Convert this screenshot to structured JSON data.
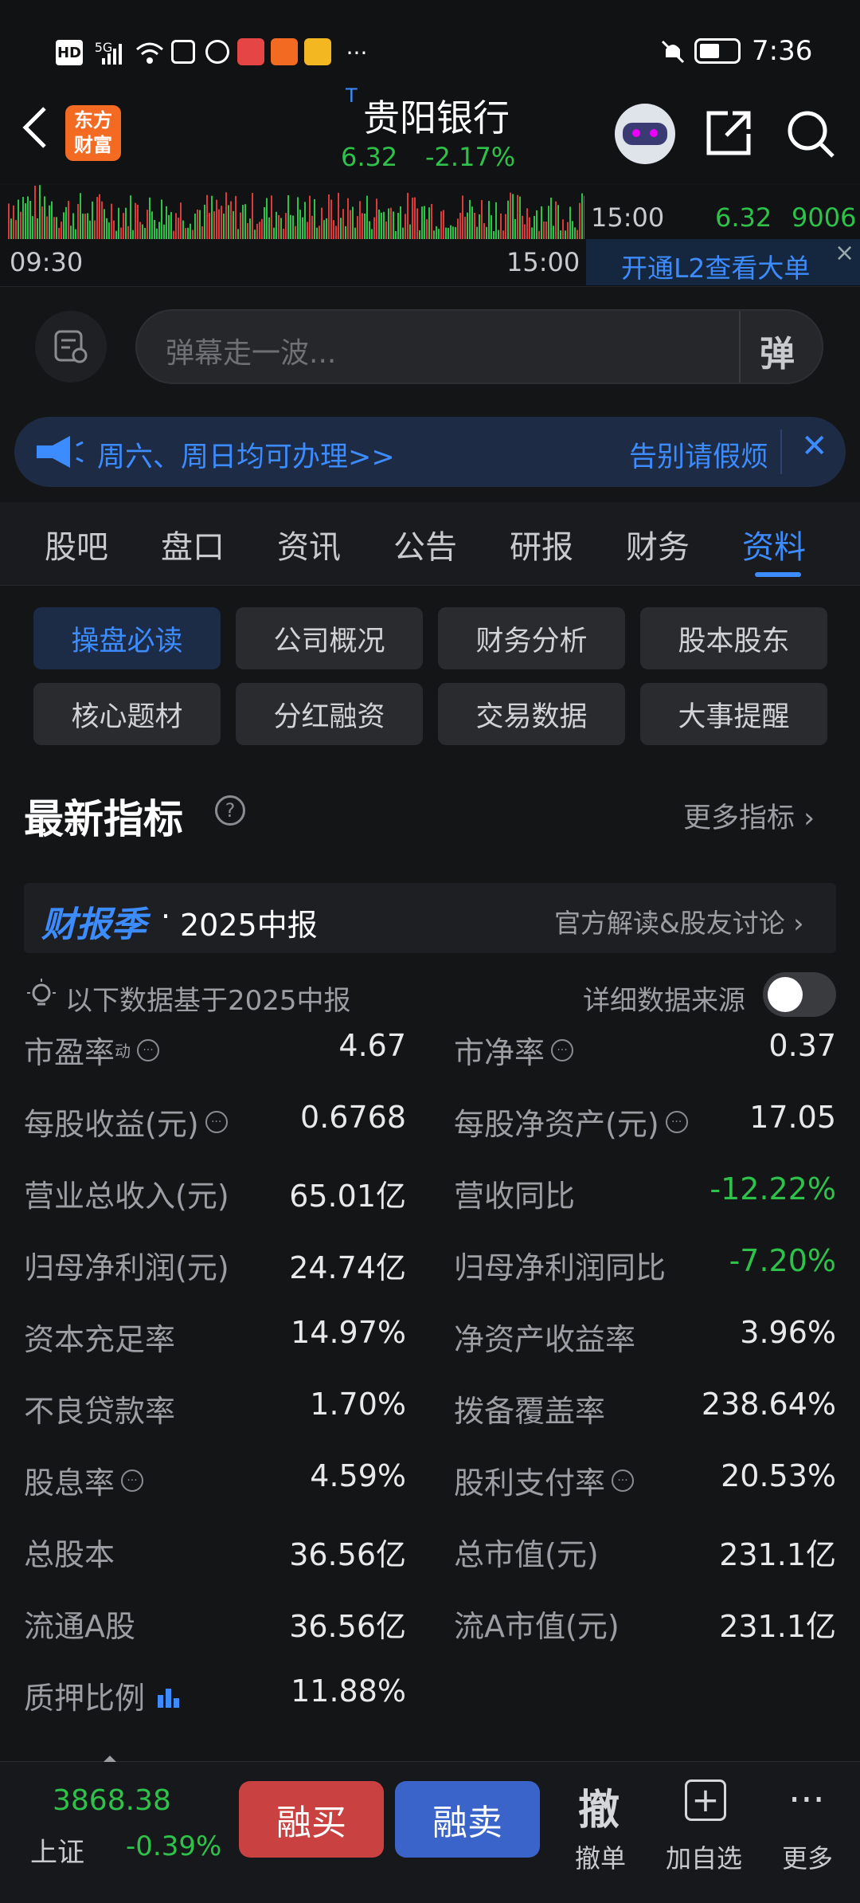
{
  "status_bar": {
    "left_labels": [
      "HD",
      "5G"
    ],
    "time": "7:36",
    "dots": "···"
  },
  "header": {
    "back": "‹",
    "logo_line1": "东方",
    "logo_line2": "财富",
    "title_prefix": "T",
    "title": "贵阳银行",
    "price": "6.32",
    "change": "-2.17%"
  },
  "timeline": {
    "start": "09:30",
    "end": "15:00",
    "right_time": "15:00",
    "right_price": "6.32",
    "right_vol": "9006",
    "l2_text": "开通L2查看大单",
    "close": "×"
  },
  "danmu": {
    "placeholder": "弹幕走一波...",
    "toggle_label": "弹"
  },
  "notice": {
    "text": "周六、周日均可办理>>",
    "text2": "告别请假烦",
    "close": "✕"
  },
  "tabs": {
    "items": [
      "股吧",
      "盘口",
      "资讯",
      "公告",
      "研报",
      "财务",
      "资料"
    ],
    "active_index": 6
  },
  "chips": [
    [
      "操盘必读",
      "公司概况",
      "财务分析",
      "股本股东"
    ],
    [
      "核心题材",
      "分红融资",
      "交易数据",
      "大事提醒"
    ]
  ],
  "indicators": {
    "title": "最新指标",
    "more": "更多指标 ›"
  },
  "report_banner": {
    "brand": "财报季",
    "dot": "·",
    "period": "2025中报",
    "link": "官方解读&股友讨论 ›"
  },
  "basis": {
    "text": "以下数据基于2025中报",
    "source_label": "详细数据来源"
  },
  "rows": [
    {
      "l_label": "市盈率",
      "l_sup": "动",
      "l_q": true,
      "l_val": "4.67",
      "r_label": "市净率",
      "r_q": true,
      "r_val": "0.37",
      "r_green": false,
      "l_green": false
    },
    {
      "l_label": "每股收益(元)",
      "l_q": true,
      "l_val": "0.6768",
      "r_label": "每股净资产(元)",
      "r_q": true,
      "r_val": "17.05",
      "r_green": false,
      "l_green": false
    },
    {
      "l_label": "营业总收入(元)",
      "l_val": "65.01亿",
      "r_label": "营收同比",
      "r_val": "-12.22%",
      "r_green": true,
      "l_green": false
    },
    {
      "l_label": "归母净利润(元)",
      "l_val": "24.74亿",
      "r_label": "归母净利润同比",
      "r_val": "-7.20%",
      "r_green": true,
      "l_green": false
    },
    {
      "l_label": "资本充足率",
      "l_val": "14.97%",
      "r_label": "净资产收益率",
      "r_val": "3.96%",
      "r_green": false,
      "l_green": false
    },
    {
      "l_label": "不良贷款率",
      "l_val": "1.70%",
      "r_label": "拨备覆盖率",
      "r_val": "238.64%",
      "r_green": false,
      "l_green": false
    },
    {
      "l_label": "股息率",
      "l_q": true,
      "l_val": "4.59%",
      "r_label": "股利支付率",
      "r_q": true,
      "r_val": "20.53%",
      "r_green": false,
      "l_green": false
    },
    {
      "l_label": "总股本",
      "l_val": "36.56亿",
      "r_label": "总市值(元)",
      "r_val": "231.1亿",
      "r_green": false,
      "l_green": false
    },
    {
      "l_label": "流通A股",
      "l_val": "36.56亿",
      "r_label": "流A市值(元)",
      "r_val": "231.1亿",
      "r_green": false,
      "l_green": false
    },
    {
      "l_label": "质押比例",
      "l_chart": true,
      "l_val": "11.88%",
      "l_green": false
    }
  ],
  "bottom": {
    "index_value": "3868.38",
    "index_name": "上证",
    "index_change": "-0.39%",
    "buy": "融买",
    "sell": "融卖",
    "cancel_glyph": "撤",
    "cancel": "撤单",
    "add": "加自选",
    "more": "更多"
  },
  "colors": {
    "accent": "#3d8cff",
    "green": "#2ec24a",
    "buy_red": "#c94141",
    "sell_blue": "#3a64c9",
    "logo_orange": "#f36a22"
  }
}
